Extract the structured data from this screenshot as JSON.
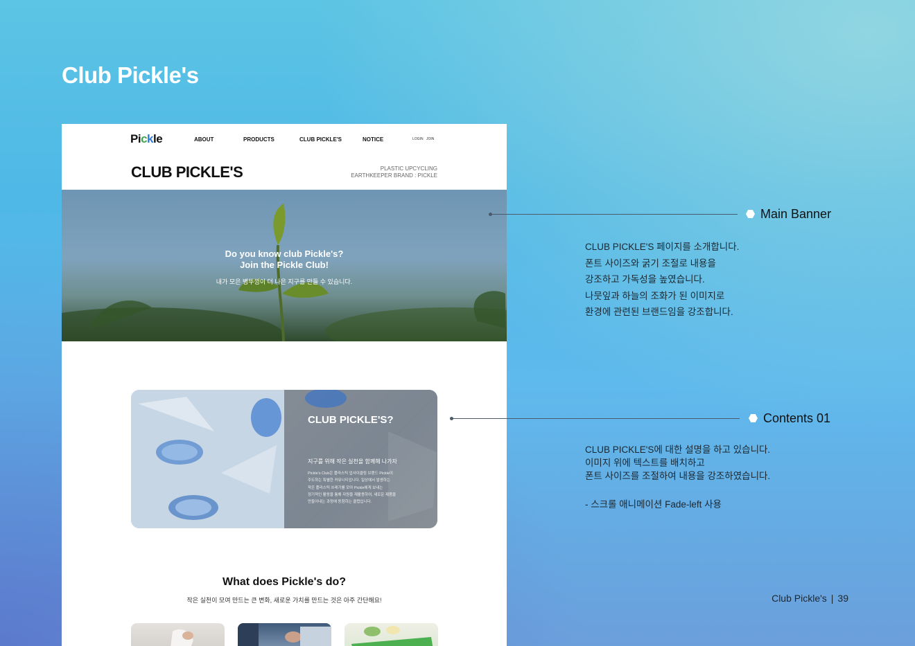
{
  "deck": {
    "title": "Club Pickle's",
    "footer": {
      "label": "Club Pickle's",
      "separator": "|",
      "page": "39"
    }
  },
  "mock": {
    "nav": {
      "logo": {
        "p1": "Pi",
        "c": "c",
        "k": "k",
        "p2": "le"
      },
      "items": [
        "ABOUT",
        "PRODUCTS",
        "CLUB PICKLE'S",
        "NOTICE"
      ],
      "login": "LOGIN",
      "join": "JOIN"
    },
    "page_title": "CLUB PICKLE'S",
    "page_subtitle": [
      "PLASTIC UPCYCLING",
      "EARTHKEEPER BRAND : PICKLE"
    ],
    "banner": {
      "line1": "Do you know club Pickle's?",
      "line2": "Join the Pickle Club!",
      "line3": "내가 모은 병뚜껑이 더 나은 지구를 만들 수 있습니다."
    },
    "card": {
      "title": "CLUB PICKLE'S?",
      "subtitle": "지구를 위해 작은 실천을 함께해 나가자",
      "body": [
        "Pickle's Club은 플라스틱 업사이클링 브랜드 Pickle이",
        "주도하는 특별한 커뮤니티입니다. 일상에서 발생하는",
        "작은 플라스틱 쓰레기를 모아 Pickle에게 보내는",
        "정기적인 활동을 통해 자원을 재활용하여, 새로운 제품을",
        "만들어내는 과정에 동참하는 클럽입니다."
      ]
    },
    "section": {
      "title": "What does Pickle's do?",
      "subtitle": "작은 실천이 모여 만드는 큰 변화, 새로운 가치를 만드는 것은 아주 간단해요!"
    }
  },
  "annotations": [
    {
      "title": "Main Banner",
      "lines": [
        "CLUB PICKLE'S 페이지를 소개합니다.",
        "폰트 사이즈와 굵기 조절로 내용을",
        "강조하고 가독성을 높였습니다.",
        "나뭇잎과 하늘의 조화가 된 이미지로",
        "환경에 관련된 브랜드임을 강조합니다."
      ]
    },
    {
      "title": "Contents 01",
      "lines": [
        "CLUB PICKLE'S에 대한 설명을 하고 있습니다.",
        "이미지 위에 텍스트를 배치하고",
        "폰트 사이즈를 조절하여 내용을 강조하였습니다.",
        "",
        "- 스크롤 애니메이션 Fade-left 사용"
      ]
    }
  ],
  "colors": {
    "logo_c": "#3aa64a",
    "logo_k": "#2c7bd8",
    "background_top": "#5cc4e4",
    "background_bottom": "#6b9fdc"
  }
}
